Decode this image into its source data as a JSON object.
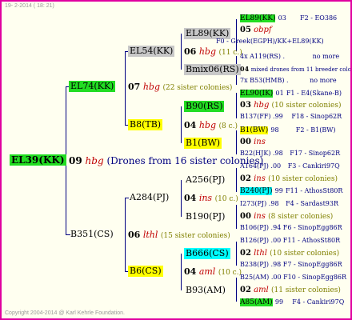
{
  "header_date": "19-  2-2014 ( 18: 21)",
  "copyright": "Copyright 2004-2014 @ Karl Kehrle Foundation.",
  "root": {
    "id": "EL39(KK)",
    "year": "09",
    "queen": "hbg",
    "note": "(Drones from 16 sister colonies)"
  },
  "g1": {
    "top": {
      "id": "EL74(KK)",
      "year": "07",
      "queen": "hbg",
      "note": "(22 sister colonies)"
    },
    "bot": {
      "id": "B351(CS)",
      "year": "06",
      "queen": "lthl",
      "note": "(15 sister colonies)"
    }
  },
  "g2": {
    "a": {
      "id": "EL54(KK)",
      "year": "06",
      "queen": "hbg",
      "note": "(11 c.)"
    },
    "b": {
      "id": "B8(TB)",
      "year": "04",
      "queen": "hbg",
      "note": "(8 c.)"
    },
    "c": {
      "id": "A284(PJ)",
      "year": "04",
      "queen": "ins",
      "note": "(10 c.)"
    },
    "d": {
      "id": "B6(CS)",
      "year": "04",
      "queen": "aml",
      "note": "(10 c.)"
    }
  },
  "g3": {
    "a": "EL89(KK)",
    "b": "Bmix06(RS)",
    "c": "B90(RS)",
    "d": "B1(BW)",
    "e": "A256(PJ)",
    "f": "B190(PJ)",
    "g": "B666(CS)",
    "h": "B93(AM)"
  },
  "right": [
    {
      "id": "EL89(KK)",
      "yr": "03",
      "sub": "F2 - EO386"
    },
    {
      "yr": "05",
      "q": "obpf"
    },
    {
      "text": "F0 - Greek(EGPH)/KK+EL89(KK)"
    },
    {
      "text": "4x A119(RS) .",
      "sub": "no more"
    },
    {
      "yr": "04",
      "text": "mixed drones from 11 breeder colonies"
    },
    {
      "text": "7x B53(HMB) .",
      "sub": "no more"
    },
    {
      "id": "EL90(IK)",
      "yr": "01",
      "sub": "F1 - E4(Skane-B)"
    },
    {
      "yr": "03",
      "q": "hbg",
      "note": "(10 sister colonies)"
    },
    {
      "text": "B137(FF) .99",
      "sub": "F18 - Sinop62R"
    },
    {
      "id": "B1(BW)",
      "yr": "98",
      "sub": "F2 - B1(BW)"
    },
    {
      "yr": "00",
      "q": "ins"
    },
    {
      "text": "B22(HJK) .98",
      "sub": "F17 - Sinop62R"
    },
    {
      "text": "A164(PJ) .00",
      "sub": "F3 - Cankiri97Q"
    },
    {
      "yr": "02",
      "q": "ins",
      "note": "(10 sister colonies)"
    },
    {
      "id": "B240(PJ)",
      "yr": "99",
      "sub": "F11 - AthosSt80R"
    },
    {
      "text": "I273(PJ) .98",
      "sub": "F4 - Sardast93R"
    },
    {
      "yr": "00",
      "q": "ins",
      "note": "(8 sister colonies)"
    },
    {
      "text": "B106(PJ) .94",
      "sub": "F6 - SinopEgg86R"
    },
    {
      "text": "B126(PJ) .00",
      "sub": "F11 - AthosSt80R"
    },
    {
      "yr": "02",
      "q": "lthl",
      "note": "(10 sister colonies)"
    },
    {
      "text": "B238(PJ) .98",
      "sub": "F7 - SinopEgg86R"
    },
    {
      "text": "B25(AM) .00",
      "sub": "F10 - SinopEgg86R"
    },
    {
      "yr": "02",
      "q": "aml",
      "note": "(11 sister colonies)"
    },
    {
      "id": "A85(AM)",
      "yr": "99",
      "sub": "F4 - Cankiri97Q"
    }
  ]
}
